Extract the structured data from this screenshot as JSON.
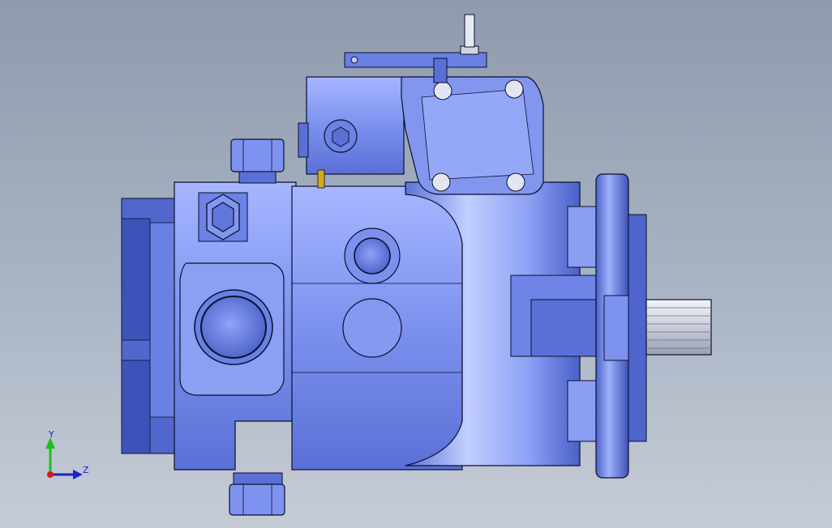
{
  "viewport": {
    "background_top": "#8f9bad",
    "background_bottom": "#c6ccd6"
  },
  "model": {
    "body_color": "#7f95f0",
    "highlight_color": "#b9c8ff",
    "shadow_color": "#3d52b8",
    "edge_color": "#0a0f2e",
    "shaft_color": "#e6e9f2",
    "pin_color": "#d8a818"
  },
  "triad": {
    "y_label": "Y",
    "z_label": "Z",
    "y_color": "#19c21b",
    "z_color": "#1a24c8",
    "x_color": "#d41b1b"
  }
}
